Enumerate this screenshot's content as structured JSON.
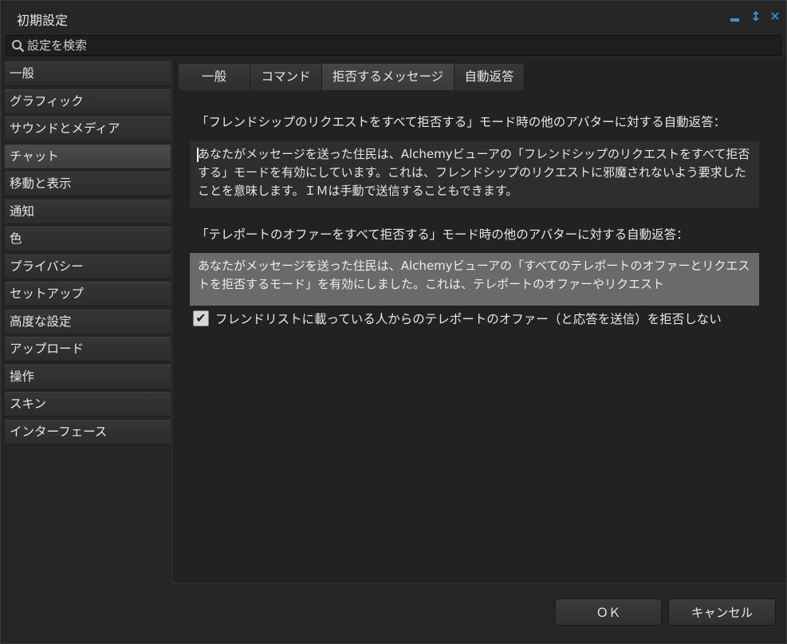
{
  "window": {
    "title": "初期設定",
    "controls": {
      "minimize": "minimize-icon",
      "maximize": "↕",
      "close": "✕"
    }
  },
  "search": {
    "placeholder": "設定を検索",
    "value": ""
  },
  "sidebar": {
    "items": [
      {
        "label": "一般"
      },
      {
        "label": "グラフィック"
      },
      {
        "label": "サウンドとメディア"
      },
      {
        "label": "チャット",
        "active": true
      },
      {
        "label": "移動と表示"
      },
      {
        "label": "通知"
      },
      {
        "label": "色"
      },
      {
        "label": "プライバシー"
      },
      {
        "label": "セットアップ"
      },
      {
        "label": "高度な設定"
      },
      {
        "label": "アップロード"
      },
      {
        "label": "操作"
      },
      {
        "label": "スキン"
      },
      {
        "label": "インターフェース"
      }
    ]
  },
  "tabs": [
    {
      "label": "一般"
    },
    {
      "label": "コマンド"
    },
    {
      "label": "拒否するメッセージ",
      "active": true
    },
    {
      "label": "自動返答"
    }
  ],
  "main": {
    "friendship_label": "「フレンドシップのリクエストをすべて拒否する」モード時の他のアバターに対する自動返答：",
    "friendship_text": "あなたがメッセージを送った住民は、Alchemyビューアの「フレンドシップのリクエストをすべて拒否する」モードを有効にしています。これは、フレンドシップのリクエストに邪魔されないよう要求したことを意味します。ＩＭは手動で送信することもできます。",
    "teleport_label": "「テレポートのオファーをすべて拒否する」モード時の他のアバターに対する自動返答：",
    "teleport_text": "あなたがメッセージを送った住民は、Alchemyビューアの「すべてのテレポートのオファーとリクエストを拒否するモード」を有効にしました。これは、テレポートのオファーやリクエスト",
    "checkbox_label": "フレンドリストに載っている人からのテレポートのオファー（と応答を送信）を拒否しない",
    "checkbox_checked": true,
    "checkmark": "✔"
  },
  "footer": {
    "ok_label": "ＯＫ",
    "cancel_label": "キャンセル"
  },
  "colors": {
    "accent": "#2e9be0",
    "background": "#252525",
    "disabled_box": "#6a6a6a"
  }
}
